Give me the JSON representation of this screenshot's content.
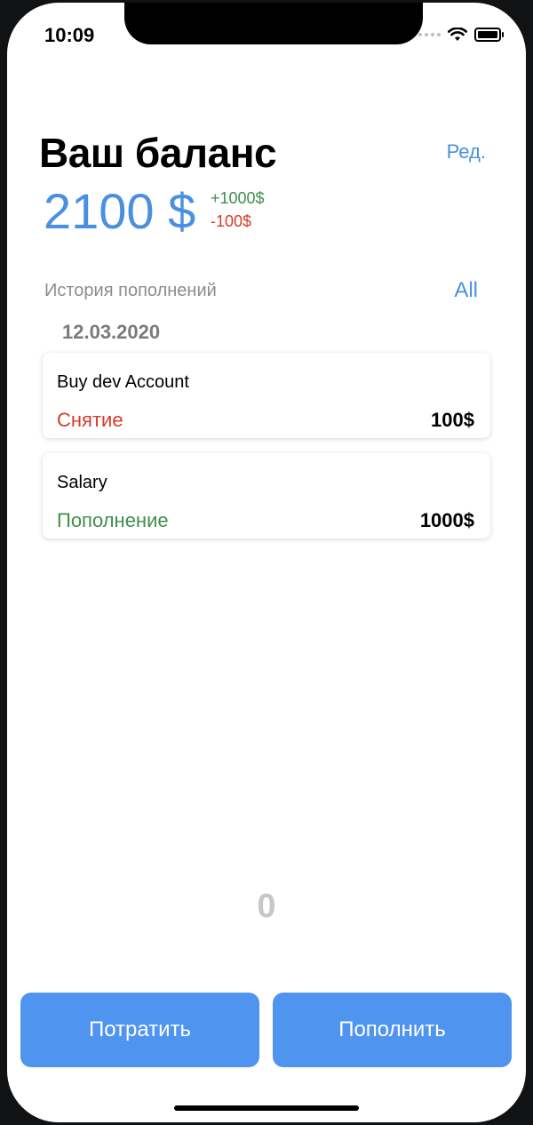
{
  "status_bar": {
    "time": "10:09"
  },
  "header": {
    "title": "Ваш баланс",
    "edit_label": "Ред."
  },
  "balance": {
    "amount": "2100 $",
    "income": "+1000$",
    "expense": "-100$"
  },
  "history": {
    "title": "История пополнений",
    "all_label": "All",
    "date": "12.03.2020",
    "items": [
      {
        "name": "Buy dev Account",
        "type": "Снятие",
        "amount": "100$"
      },
      {
        "name": "Salary",
        "type": "Пополнение",
        "amount": "1000$"
      }
    ]
  },
  "counter": "0",
  "actions": {
    "spend_label": "Потратить",
    "topup_label": "Пополнить"
  },
  "colors": {
    "accent": "#4a90e2",
    "button": "#4f94ef",
    "positive": "#3f8f4a",
    "negative": "#d93a2b"
  }
}
